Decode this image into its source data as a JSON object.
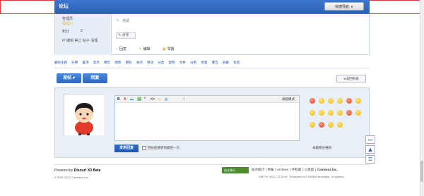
{
  "header": {
    "forum_label": "论坛",
    "quicknav_label": "快捷导航"
  },
  "post": {
    "role": "管理员",
    "score_label": "积分",
    "score_value": "3",
    "ip_line": "IP 编辑 禁止 帖子 清理",
    "test_text": "测试",
    "comment_label": "点评",
    "actions": [
      "回复",
      "编辑",
      "举报"
    ]
  },
  "modbar": [
    "删除主题",
    "升降",
    "置顶",
    "高亮",
    "精华",
    "图章",
    "图标",
    "关闭",
    "移动",
    "分类",
    "复制",
    "合并",
    "分割",
    "修复",
    "警告",
    "屏蔽",
    "标签"
  ],
  "buttons": {
    "post": "发帖",
    "reply": "回复",
    "back": "返回列表"
  },
  "editor": {
    "toolbar": [
      "B",
      "A",
      "▬",
      "🖼",
      "\"",
      "<>",
      "☺",
      "◎"
    ],
    "advanced_mode": "高级模式",
    "submit": "发表回复",
    "checkbox_label": "回帖后跳转到最后一页",
    "rules_link": "本版积分规则"
  },
  "footer": {
    "powered_prefix": "Powered by ",
    "powered_brand": "Discuz! X3 Beta",
    "copyright": "© 2001-2012 Comsenz Inc.",
    "badge": "站长统计",
    "links": [
      "站点统计",
      "举报",
      "Archiver",
      "手机版",
      "小黑屋",
      "Comsenz Inc."
    ],
    "gmt": "GMT+8, 2012-7-3 15:43 , Processed in 0.049648 second(s), 20 queries ."
  },
  "colors": {
    "accent": "#2b64c0",
    "frame": "#e03a3a"
  }
}
